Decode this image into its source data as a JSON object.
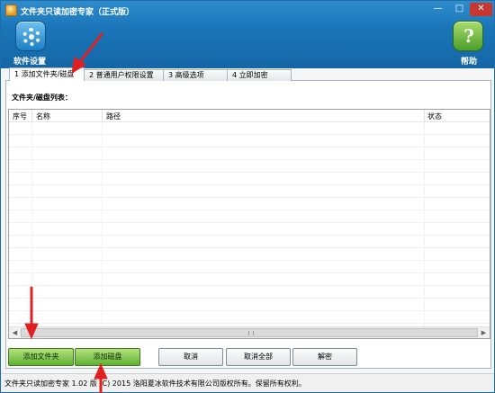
{
  "window": {
    "title": "文件夹只读加密专家（正式版）",
    "minimize_glyph": "—",
    "maximize_glyph": "□",
    "close_glyph": "✕"
  },
  "toolbar": {
    "settings_label": "软件设置",
    "help_label": "帮助",
    "help_glyph": "?"
  },
  "tabs": [
    {
      "label": "1 添加文件夹/磁盘",
      "active": true
    },
    {
      "label": "2 普通用户权限设置",
      "active": false
    },
    {
      "label": "3 高级选项",
      "active": false
    },
    {
      "label": "4 立即加密",
      "active": false
    }
  ],
  "list": {
    "title": "文件夹/磁盘列表：",
    "columns": [
      "序号",
      "名称",
      "路径",
      "状态"
    ]
  },
  "scrollbar": {
    "left_arrow": "◀",
    "right_arrow": "▶"
  },
  "buttons": {
    "add_folder": "添加文件夹",
    "add_disk": "添加磁盘",
    "cancel": "取消",
    "cancel_all": "取消全部",
    "decrypt": "解密"
  },
  "status": {
    "text": "文件夹只读加密专家 1.02 版 (C) 2015 洛阳夏冰软件技术有限公司版权所有。保留所有权利。"
  },
  "colors": {
    "header_blue": "#1a76b8",
    "button_green": "#5eb132",
    "annotation_red": "#e02020"
  },
  "icons": {
    "settings": "gear-icon",
    "help": "help-icon",
    "app": "app-icon"
  }
}
